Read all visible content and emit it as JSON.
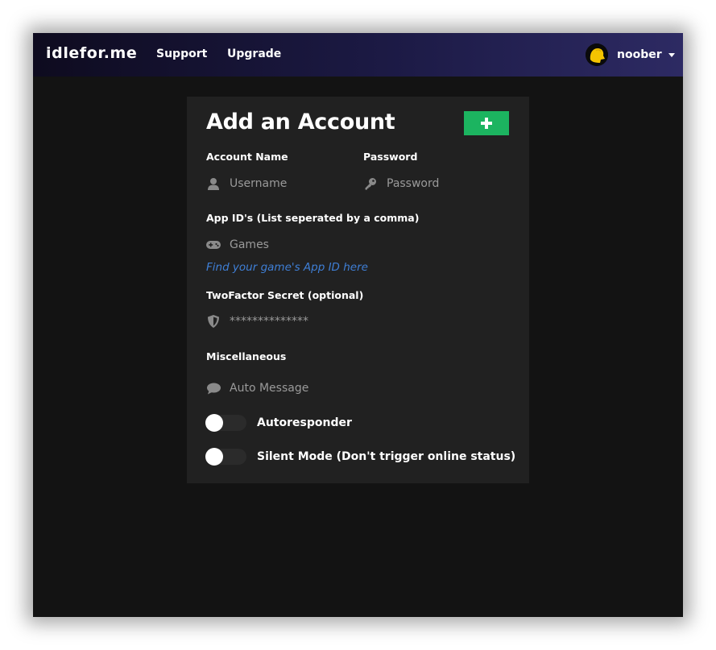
{
  "navbar": {
    "brand": "idlefor.me",
    "links": [
      {
        "label": "Support"
      },
      {
        "label": "Upgrade"
      }
    ],
    "user": {
      "name": "noober",
      "avatar_color": "#f5c400"
    }
  },
  "form": {
    "title": "Add an Account",
    "add_button_symbol": "+",
    "add_button_color": "#1cb460",
    "account_name": {
      "label": "Account Name",
      "placeholder": "Username",
      "icon": "user-icon"
    },
    "password": {
      "label": "Password",
      "placeholder": "Password",
      "icon": "key-icon"
    },
    "app_ids": {
      "label": "App ID's (List seperated by a comma)",
      "placeholder": "Games",
      "icon": "gamepad-icon"
    },
    "app_id_help_link": "Find your game's App ID here",
    "twofactor": {
      "label": "TwoFactor Secret (optional)",
      "placeholder": "**************",
      "icon": "shield-icon"
    },
    "misc": {
      "label": "Miscellaneous",
      "placeholder": "Auto Message",
      "icon": "comment-icon"
    },
    "toggles": [
      {
        "label": "Autoresponder",
        "on": false
      },
      {
        "label": "Silent Mode (Don't trigger online status)",
        "on": false
      }
    ]
  }
}
